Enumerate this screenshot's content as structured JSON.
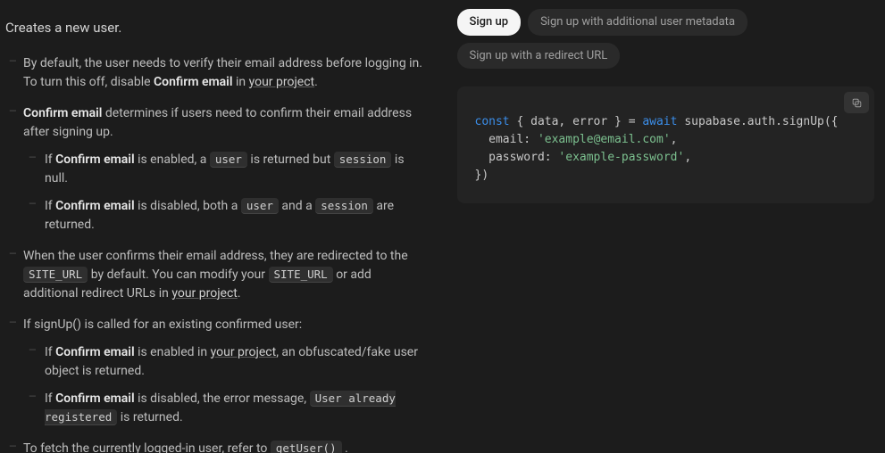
{
  "heading": "Creates a new user.",
  "inline": {
    "confirm_email": "Confirm email",
    "your_project": "your project",
    "user": "user",
    "session": "session",
    "site_url": "SITE_URL",
    "already": "User already registered",
    "getUser": "getUser()"
  },
  "txt": {
    "b1a": "By default, the user needs to verify their email address before logging in. To turn this off, disable ",
    "b1b": " in ",
    "b1c": ".",
    "b2a": " determines if users need to confirm their email address after signing up.",
    "b2s1a": "If ",
    "b2s1b": " is enabled, a ",
    "b2s1c": " is returned but ",
    "b2s1d": " is null.",
    "b2s2a": "If ",
    "b2s2b": " is disabled, both a ",
    "b2s2c": " and a ",
    "b2s2d": " are returned.",
    "b3a": "When the user confirms their email address, they are redirected to the ",
    "b3b": " by default. You can modify your ",
    "b3c": " or add additional redirect URLs in ",
    "b3d": ".",
    "b4": "If signUp() is called for an existing confirmed user:",
    "b4s1a": "If ",
    "b4s1b": " is enabled in ",
    "b4s1c": ", an obfuscated/fake user object is returned.",
    "b4s2a": "If ",
    "b4s2b": " is disabled, the error message, ",
    "b4s2c": " is returned.",
    "b5a": "To fetch the currently logged-in user, refer to ",
    "b5b": " ."
  },
  "tabs": [
    {
      "label": "Sign up",
      "active": true
    },
    {
      "label": "Sign up with additional user metadata",
      "active": false
    },
    {
      "label": "Sign up with a redirect URL",
      "active": false
    }
  ],
  "code": {
    "l1a": "const",
    "l1b": " { data, error } = ",
    "l1c": "await",
    "l1d": " supabase.auth.signUp({",
    "l2a": "  email: ",
    "l2b": "'example@email.com'",
    "l2c": ",",
    "l3a": "  password: ",
    "l3b": "'example-password'",
    "l3c": ",",
    "l4": "})"
  }
}
